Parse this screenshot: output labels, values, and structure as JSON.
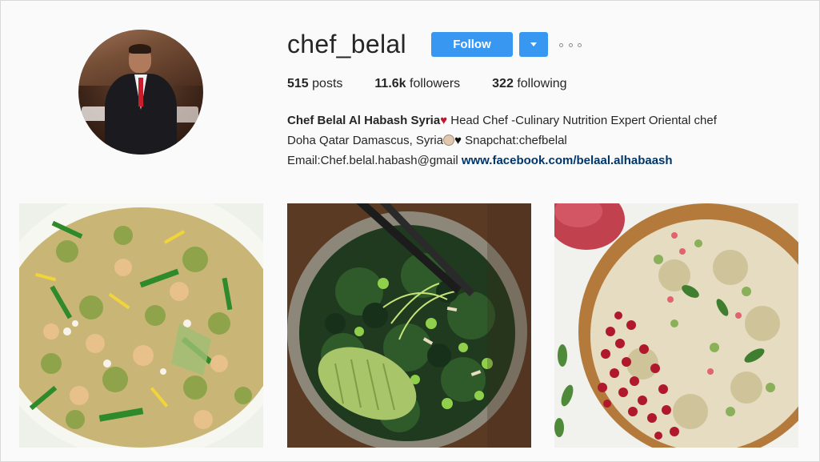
{
  "profile": {
    "username": "chef_belal",
    "follow_label": "Follow",
    "dropdown_icon": "chevron-down-icon",
    "more_icon": "more-options-icon",
    "avatar": "profile-photo"
  },
  "stats": {
    "posts_count": "515",
    "posts_label": "posts",
    "followers_count": "11.6k",
    "followers_label": "followers",
    "following_count": "322",
    "following_label": "following"
  },
  "bio": {
    "full_name": "Chef Belal Al Habash Syria",
    "line1_rest": " Head Chef -Culinary Nutrition Expert Oriental chef",
    "line2_text": "Doha Qatar Damascus, Syria",
    "line2_rest": " Snapchat:chefbelal",
    "line3_text": "Email:Chef.belal.habash@gmail ",
    "link": "www.facebook.com/belaal.alhabaash"
  },
  "posts": [
    {
      "name": "quinoa-chickpea-salad"
    },
    {
      "name": "kale-avocado-bowl"
    },
    {
      "name": "pomegranate-quinoa-salad"
    }
  ],
  "colors": {
    "follow_button": "#3897f0",
    "link": "#003569",
    "heart": "#c3162c"
  }
}
